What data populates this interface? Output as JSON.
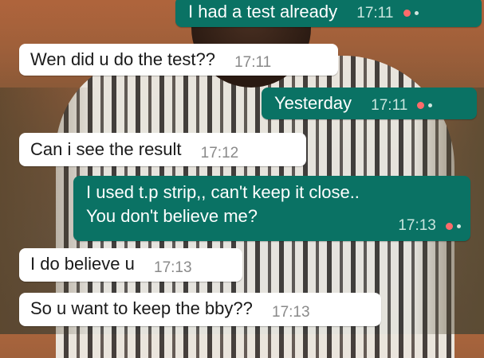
{
  "messages": [
    {
      "id": "m1",
      "dir": "out",
      "lines": [
        "I had a test already"
      ],
      "time": "17:11"
    },
    {
      "id": "m2",
      "dir": "in",
      "lines": [
        "Wen did u do the test??"
      ],
      "time": "17:11"
    },
    {
      "id": "m3",
      "dir": "out",
      "lines": [
        "Yesterday"
      ],
      "time": "17:11"
    },
    {
      "id": "m4",
      "dir": "in",
      "lines": [
        "Can i see the result"
      ],
      "time": "17:12"
    },
    {
      "id": "m5",
      "dir": "out",
      "lines": [
        "I used t.p strip,, can't keep it close..",
        "You don't believe me?"
      ],
      "time": "17:13"
    },
    {
      "id": "m6",
      "dir": "in",
      "lines": [
        "I do believe u"
      ],
      "time": "17:13"
    },
    {
      "id": "m7",
      "dir": "in",
      "lines": [
        "So u want to keep the bby??"
      ],
      "time": "17:13"
    }
  ],
  "colors": {
    "outgoing": "#0a7264",
    "incoming": "#ffffff",
    "status_dot": "#ff6b6b"
  },
  "icons": {
    "status": "read-status-icon"
  }
}
